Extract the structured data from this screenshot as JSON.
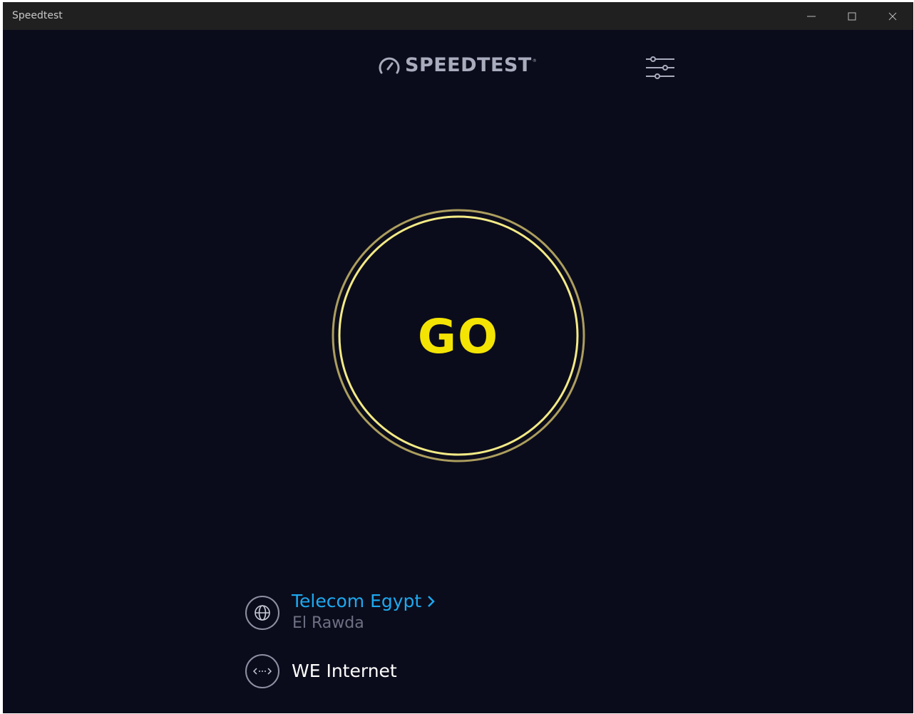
{
  "window": {
    "title": "Speedtest",
    "controls": {
      "minimize": "minimize-icon",
      "maximize": "maximize-icon",
      "close": "close-icon"
    }
  },
  "header": {
    "logo_text": "SPEEDTEST",
    "logo_tm": "®",
    "settings_icon": "settings-sliders-icon"
  },
  "start": {
    "label": "GO",
    "accent": "#f4e404"
  },
  "server": {
    "provider": "Telecom Egypt",
    "location": "El Rawda",
    "icon": "globe-icon",
    "link_color": "#1da9f0"
  },
  "connection": {
    "isp": "WE Internet",
    "icon": "connection-icon"
  }
}
